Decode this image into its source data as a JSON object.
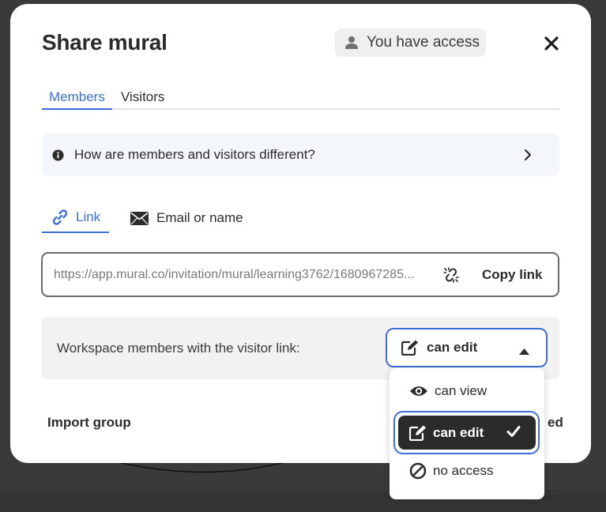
{
  "modal": {
    "title": "Share mural",
    "access_badge": {
      "label": "You have access",
      "icon": "person-icon"
    },
    "close_icon": "close-icon"
  },
  "tabs": [
    {
      "label": "Members",
      "active": true
    },
    {
      "label": "Visitors",
      "active": false
    }
  ],
  "info": {
    "text": "How are members and visitors different?",
    "icon": "info-icon",
    "chevron": "chevron-right-icon"
  },
  "share_methods": [
    {
      "label": "Link",
      "icon": "link-icon",
      "active": true
    },
    {
      "label": "Email or name",
      "icon": "envelope-icon",
      "active": false
    }
  ],
  "link": {
    "url": "https://app.mural.co/invitation/mural/learning3762/1680967285...",
    "reset_icon": "broken-link-icon",
    "copy_label": "Copy link"
  },
  "permission": {
    "label": "Workspace members with the visitor link:",
    "selected": "can edit",
    "selected_icon": "edit-icon",
    "caret_icon": "caret-up-icon",
    "options": [
      {
        "label": "can view",
        "icon": "eye-icon",
        "selected": false
      },
      {
        "label": "can edit",
        "icon": "edit-icon",
        "selected": true
      },
      {
        "label": "no access",
        "icon": "no-access-icon",
        "selected": false
      }
    ]
  },
  "footer": {
    "import_group": "Import group",
    "truncated_text": "ed"
  },
  "colors": {
    "accent": "#3c6fd6",
    "dark": "#2b2b2b",
    "backdrop": "#3a3a3a"
  }
}
